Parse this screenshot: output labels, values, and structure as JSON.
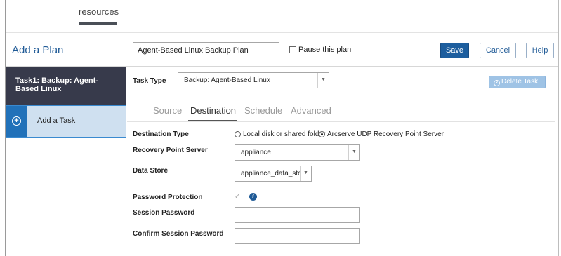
{
  "nav": {
    "active_tab": "resources"
  },
  "page": {
    "title": "Add a Plan"
  },
  "plan": {
    "name_value": "Agent-Based Linux Backup Plan",
    "pause_label": "Pause this plan",
    "pause_checked": false
  },
  "toolbar": {
    "save_label": "Save",
    "cancel_label": "Cancel",
    "help_label": "Help"
  },
  "tasks": {
    "items": [
      {
        "label": "Task1: Backup: Agent-Based Linux",
        "selected": true
      }
    ],
    "add_label": "Add a Task"
  },
  "task_type": {
    "label": "Task Type",
    "value": "Backup: Agent-Based Linux",
    "delete_label": "Delete Task"
  },
  "tabs": [
    {
      "label": "Source",
      "active": false
    },
    {
      "label": "Destination",
      "active": true
    },
    {
      "label": "Schedule",
      "active": false
    },
    {
      "label": "Advanced",
      "active": false
    }
  ],
  "destination": {
    "type_label": "Destination Type",
    "options": [
      {
        "label": "Local disk or shared folder",
        "selected": false
      },
      {
        "label": "Arcserve UDP Recovery Point Server",
        "selected": true
      }
    ],
    "rps_label": "Recovery Point Server",
    "rps_value": "appliance",
    "datastore_label": "Data Store",
    "datastore_value": "appliance_data_store",
    "password_protection_label": "Password Protection",
    "password_protection_checked": true,
    "session_password_label": "Session Password",
    "confirm_password_label": "Confirm Session Password"
  },
  "colors": {
    "primary": "#1d5e9e",
    "title": "#1f5a96",
    "task_selected_bg": "#373a4b",
    "task_add_bg": "#cfe0f0",
    "task_add_band": "#2171b9"
  }
}
